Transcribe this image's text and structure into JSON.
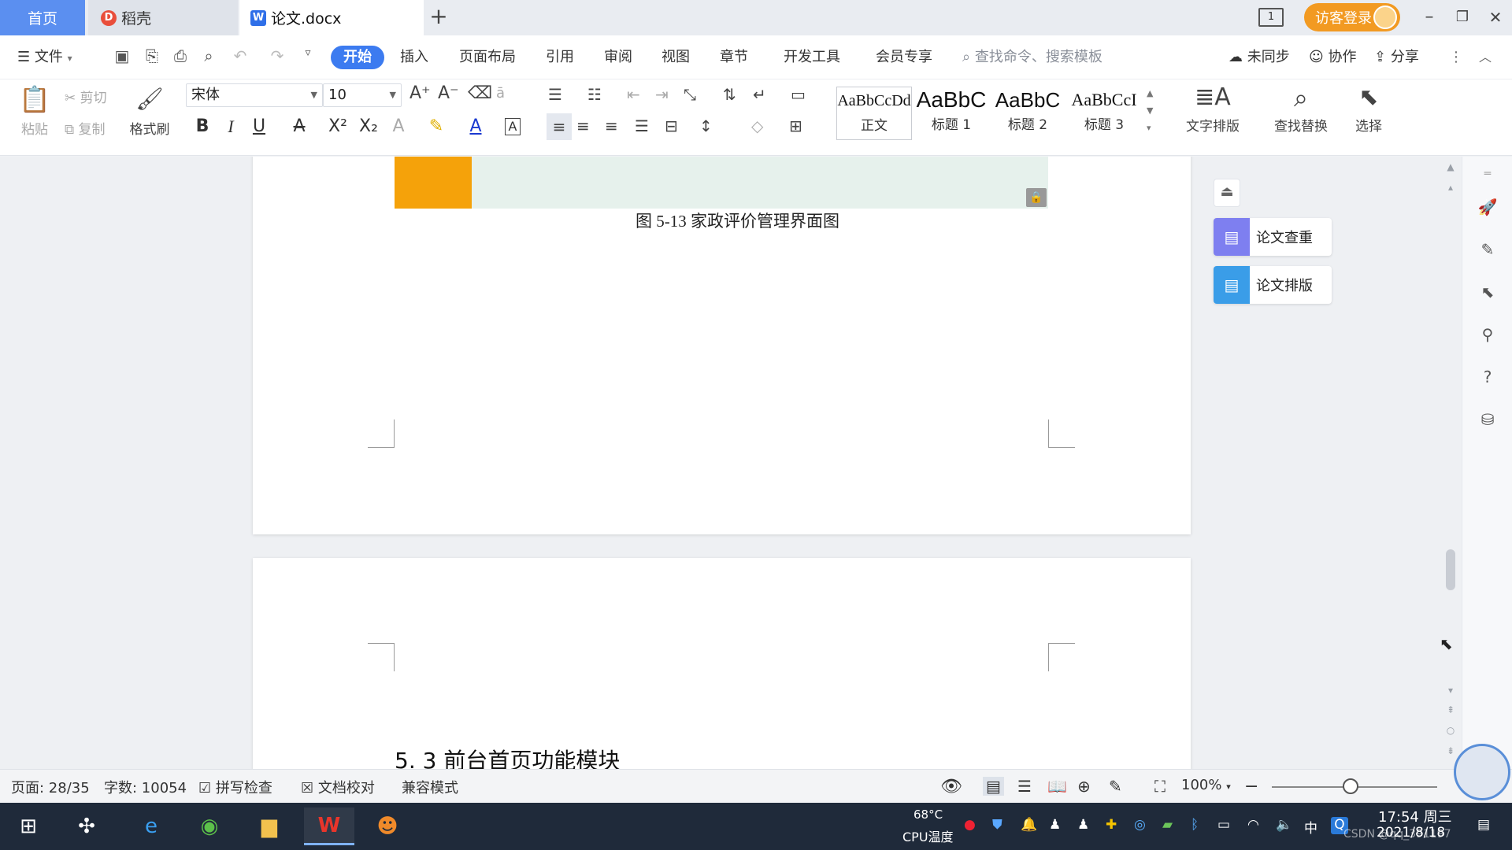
{
  "tabs": {
    "home": "首页",
    "docer": "稻壳",
    "doc": "论文.docx",
    "new": "+"
  },
  "titlebar": {
    "layout_num": "1",
    "login": "访客登录",
    "min": "–",
    "restore": "❐",
    "close": "✕"
  },
  "menu": {
    "file": "文件",
    "items": [
      "开始",
      "插入",
      "页面布局",
      "引用",
      "审阅",
      "视图",
      "章节",
      "开发工具",
      "会员专享"
    ],
    "search": "查找命令、搜索模板",
    "sync": "未同步",
    "collab": "协作",
    "share": "分享"
  },
  "ribbon": {
    "paste": "粘贴",
    "cut": "剪切",
    "copy": "复制",
    "format_painter": "格式刷",
    "font_name": "宋体",
    "font_size": "10",
    "styles": [
      {
        "sample": "AaBbCcDd",
        "name": "正文"
      },
      {
        "sample": "AaBbC",
        "name": "标题 1"
      },
      {
        "sample": "AaBbC",
        "name": "标题 2"
      },
      {
        "sample": "AaBbCcI",
        "name": "标题 3"
      }
    ],
    "text_layout": "文字排版",
    "find_replace": "查找替换",
    "select": "选择"
  },
  "document": {
    "caption": "图 5-13 家政评价管理界面图",
    "heading": "5. 3 前台首页功能模块"
  },
  "side_panel": {
    "check": "论文查重",
    "layout": "论文排版"
  },
  "status": {
    "page": "页面: 28/35",
    "words": "字数: 10054",
    "spell": "拼写检查",
    "proof": "文档校对",
    "compat": "兼容模式",
    "zoom": "100%"
  },
  "taskbar": {
    "cpu_temp": "68°C",
    "cpu_label": "CPU温度",
    "ime": "中",
    "time": "17:54 周三",
    "date": "2021/8/18",
    "watermark": "CSDN @qq_391197"
  },
  "colors": {
    "accent": "#3c7bf0",
    "login": "#f29a22",
    "image_orange": "#f5a20a",
    "image_green": "#e6f1ec"
  }
}
